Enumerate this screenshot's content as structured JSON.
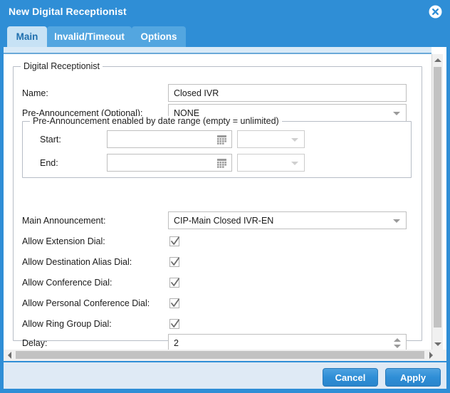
{
  "window": {
    "title": "New Digital Receptionist",
    "close_icon": "close-circle-icon",
    "accent_color": "#2f8ed6",
    "footer_color": "#dfeaf5"
  },
  "tabs": [
    {
      "label": "Main",
      "active": true
    },
    {
      "label": "Invalid/Timeout",
      "active": false
    },
    {
      "label": "Options",
      "active": false
    }
  ],
  "main_group": {
    "legend": "Digital Receptionist",
    "name": {
      "label": "Name:",
      "value": "Closed IVR"
    },
    "pre_announcement": {
      "label": "Pre-Announcement (Optional):",
      "value": "NONE"
    },
    "date_group": {
      "legend": "Pre-Announcement enabled by date range (empty = unlimited)",
      "start": {
        "label": "Start:",
        "value": "",
        "placeholder": "",
        "tz_value": ""
      },
      "end": {
        "label": "End:",
        "value": "",
        "placeholder": "",
        "tz_value": ""
      },
      "calendar_icon": "calendar-icon"
    },
    "main_announcement": {
      "label": "Main Announcement:",
      "value": "CIP-Main Closed IVR-EN"
    },
    "checkboxes": [
      {
        "label": "Allow Extension Dial:",
        "checked": true
      },
      {
        "label": "Allow Destination Alias Dial:",
        "checked": true
      },
      {
        "label": "Allow Conference Dial:",
        "checked": true
      },
      {
        "label": "Allow Personal Conference Dial:",
        "checked": true
      },
      {
        "label": "Allow Ring Group Dial:",
        "checked": true
      }
    ],
    "delay": {
      "label": "Delay:",
      "value": "2"
    }
  },
  "footer": {
    "cancel_label": "Cancel",
    "apply_label": "Apply"
  },
  "scrollbars": {
    "vertical_up_icon": "chevron-up-icon",
    "vertical_down_icon": "chevron-down-icon",
    "horizontal_left_icon": "chevron-left-icon",
    "horizontal_right_icon": "chevron-right-icon"
  }
}
